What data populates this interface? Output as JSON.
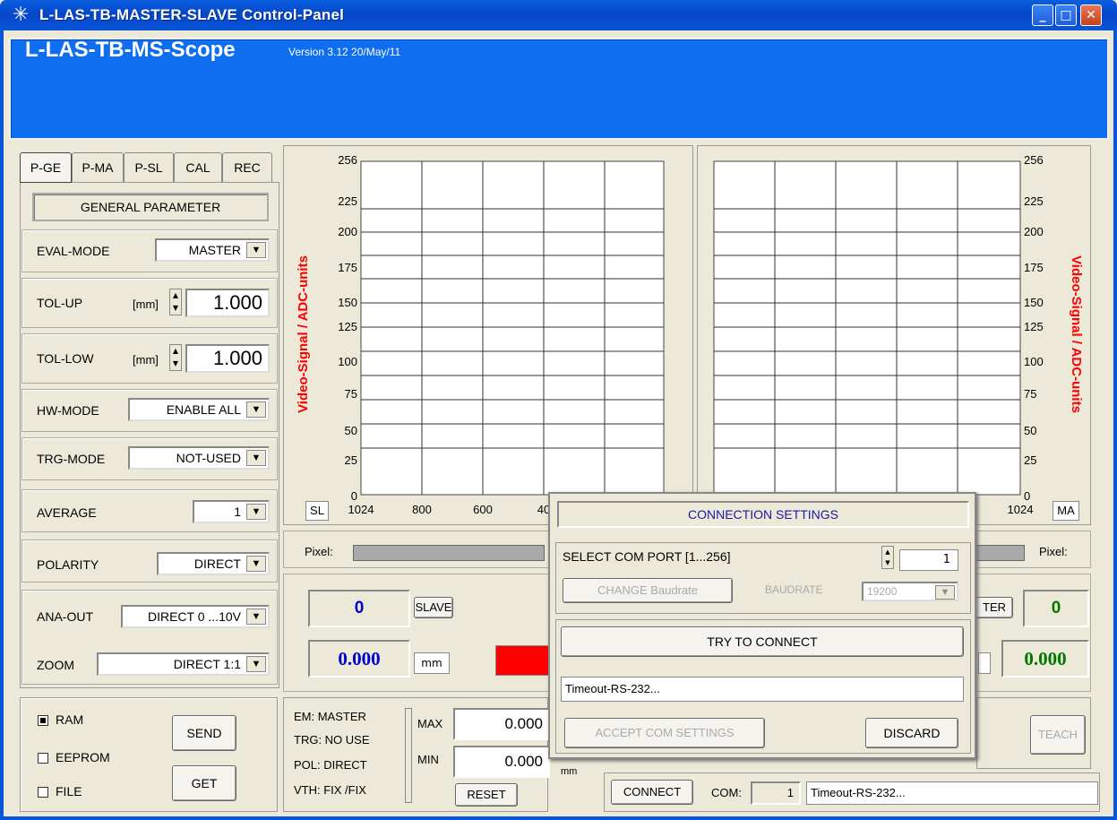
{
  "window": {
    "title": "L-LAS-TB-MASTER-SLAVE  Control-Panel"
  },
  "header": {
    "title": "L-LAS-TB-MS-Scope",
    "version": "Version 3.12  20/May/11"
  },
  "tabs": [
    "P-GE",
    "P-MA",
    "P-SL",
    "CAL",
    "REC"
  ],
  "general_parameter": {
    "title": "GENERAL PARAMETER",
    "eval_mode": {
      "label": "EVAL-MODE",
      "value": "MASTER"
    },
    "tol_up": {
      "label": "TOL-UP",
      "unit": "[mm]",
      "value": "1.000"
    },
    "tol_low": {
      "label": "TOL-LOW",
      "unit": "[mm]",
      "value": "1.000"
    },
    "hw_mode": {
      "label": "HW-MODE",
      "value": "ENABLE ALL"
    },
    "trg_mode": {
      "label": "TRG-MODE",
      "value": "NOT-USED"
    },
    "average": {
      "label": "AVERAGE",
      "value": "1"
    },
    "polarity": {
      "label": "POLARITY",
      "value": "DIRECT"
    },
    "ana_out": {
      "label": "ANA-OUT",
      "value": "DIRECT 0 ...10V"
    },
    "zoom": {
      "label": "ZOOM",
      "value": "DIRECT 1:1"
    }
  },
  "charts": {
    "left": {
      "ylabel": "Video-Signal / ADC-units",
      "corner": "SL",
      "yticks": [
        "256",
        "225",
        "200",
        "175",
        "150",
        "125",
        "100",
        "75",
        "50",
        "25",
        "0"
      ],
      "xticks": [
        "1024",
        "800",
        "600",
        "40"
      ]
    },
    "right": {
      "ylabel": "Video-Signal  / ADC-units",
      "corner": "MA",
      "yticks": [
        "256",
        "225",
        "200",
        "175",
        "150",
        "125",
        "100",
        "75",
        "50",
        "25",
        "0"
      ],
      "xticks": [
        "1024"
      ]
    }
  },
  "pixel_bar": {
    "left_label": "Pixel:",
    "right_label": "Pixel:"
  },
  "slave": {
    "count": "0",
    "label": "SLAVE",
    "value": "0.000",
    "unit": "mm"
  },
  "master": {
    "label": "TER",
    "count": "0",
    "value": "0.000"
  },
  "storage": {
    "ram": "RAM",
    "eeprom": "EEPROM",
    "file": "FILE",
    "send": "SEND",
    "get": "GET",
    "ram_checked": true
  },
  "status": {
    "em": "EM: MASTER",
    "trg": "TRG:  NO USE",
    "pol": "POL:  DIRECT",
    "vth": "VTH: FIX /FIX"
  },
  "minmax": {
    "max_label": "MAX",
    "min_label": "MIN",
    "max_value": "0.000",
    "min_value": "0.000",
    "unit": "mm",
    "reset": "RESET"
  },
  "teach": "TEACH",
  "connection_bar": {
    "connect": "CONNECT",
    "com_label": "COM:",
    "com_value": "1",
    "status": "Timeout-RS-232..."
  },
  "dialog": {
    "title": "CONNECTION SETTINGS",
    "select_com": "SELECT COM PORT [1...256]",
    "com_value": "1",
    "change_baud": "CHANGE Baudrate",
    "baudrate_label": "BAUDRATE",
    "baudrate_value": "19200",
    "try_connect": "TRY TO CONNECT",
    "status": "Timeout-RS-232...",
    "accept": "ACCEPT COM SETTINGS",
    "discard": "DISCARD"
  },
  "colors": {
    "title_bar": "#0a56d8",
    "header": "#0f6df0",
    "axis_label": "#ff0000",
    "value_blue": "#0000cc",
    "value_green": "#007700",
    "indicator_red": "#ff0000"
  }
}
